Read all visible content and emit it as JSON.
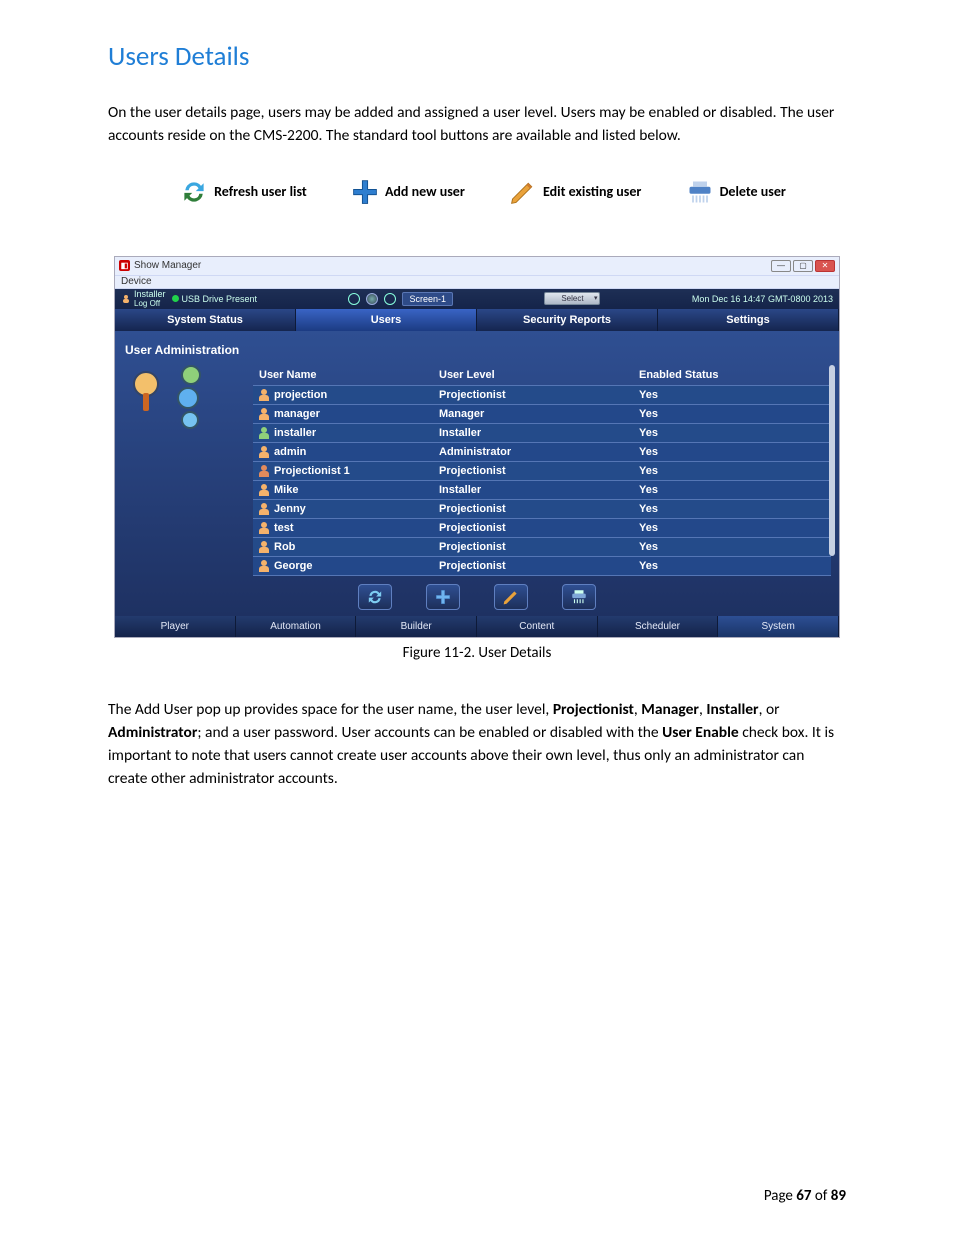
{
  "section_title": "Users Details",
  "intro_paragraph": "On the user details page, users may be added and assigned a user level.  Users may be enabled or disabled.  The user accounts reside on the CMS-2200.  The standard tool buttons are available and listed below.",
  "toolbar_legend": {
    "refresh": "Refresh user list",
    "add": "Add new user",
    "edit": "Edit existing user",
    "delete": "Delete user"
  },
  "figure_caption": "Figure 11-2.  User Details",
  "paragraph2_parts": {
    "a": "The Add User pop up provides space for the user name, the user level, ",
    "b_bold": "Projectionist",
    "c": ", ",
    "d_bold": "Manager",
    "e": ", ",
    "f_bold": "Installer",
    "g": ", or ",
    "h_bold": "Administrator",
    "i": "; and a user password.  User accounts can be enabled or disabled with the ",
    "j_bold": "User Enable",
    "k": " check box.  It is important to note that users cannot create user accounts above their own level, thus only an administrator can create other administrator accounts."
  },
  "footer": {
    "pre": "Page ",
    "cur": "67",
    "mid": " of ",
    "total": "89"
  },
  "app": {
    "title": "Show Manager",
    "menu_device": "Device",
    "status": {
      "logoff_top": "Installer",
      "logoff_bottom": "Log Off",
      "usb": "USB Drive Present",
      "screen": "Screen-1",
      "select": "Select",
      "datetime": "Mon Dec 16 14:47 GMT-0800 2013"
    },
    "primary_tabs": [
      "System Status",
      "Users",
      "Security Reports",
      "Settings"
    ],
    "primary_active": 1,
    "panel_title": "User Administration",
    "columns": [
      "User Name",
      "User Level",
      "Enabled Status"
    ],
    "users": [
      {
        "name": "projection",
        "level": "Projectionist",
        "enabled": "Yes",
        "ic": "u"
      },
      {
        "name": "manager",
        "level": "Manager",
        "enabled": "Yes",
        "ic": "u"
      },
      {
        "name": "installer",
        "level": "Installer",
        "enabled": "Yes",
        "ic": "g"
      },
      {
        "name": "admin",
        "level": "Administrator",
        "enabled": "Yes",
        "ic": "u"
      },
      {
        "name": "Projectionist 1",
        "level": "Projectionist",
        "enabled": "Yes",
        "ic": "r"
      },
      {
        "name": "Mike",
        "level": "Installer",
        "enabled": "Yes",
        "ic": "u"
      },
      {
        "name": "Jenny",
        "level": "Projectionist",
        "enabled": "Yes",
        "ic": "u"
      },
      {
        "name": "test",
        "level": "Projectionist",
        "enabled": "Yes",
        "ic": "u"
      },
      {
        "name": "Rob",
        "level": "Projectionist",
        "enabled": "Yes",
        "ic": "u"
      },
      {
        "name": "George",
        "level": "Projectionist",
        "enabled": "Yes",
        "ic": "u"
      }
    ],
    "bottom_tabs": [
      "Player",
      "Automation",
      "Builder",
      "Content",
      "Scheduler",
      "System"
    ],
    "bottom_active": 5
  }
}
